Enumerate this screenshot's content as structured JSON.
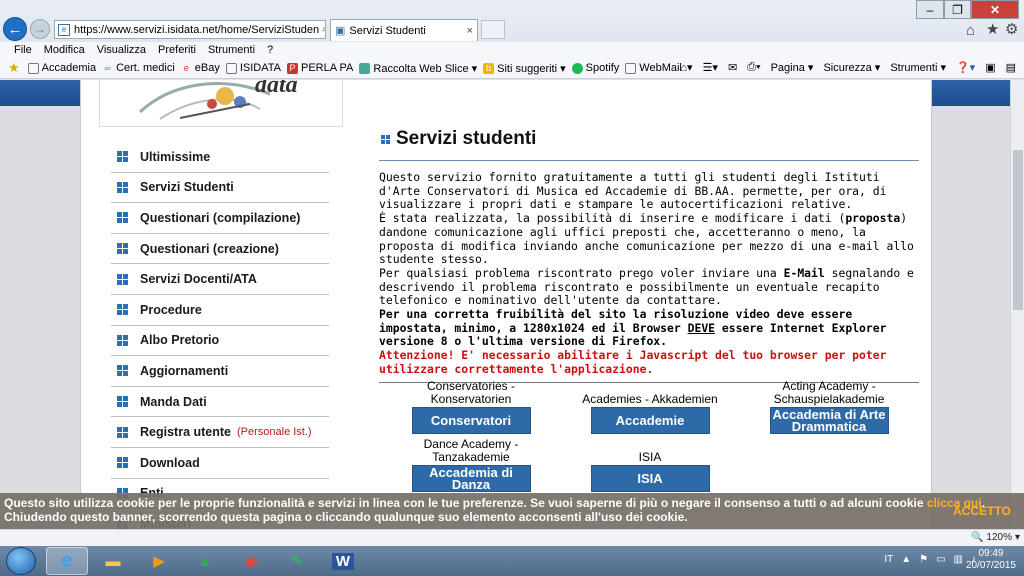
{
  "browser": {
    "url": "https://www.servizi.isidata.net/home/ServiziStuden",
    "tab_title": "Servizi Studenti",
    "tab_close": "×",
    "menu": [
      "File",
      "Modifica",
      "Visualizza",
      "Preferiti",
      "Strumenti",
      "?"
    ],
    "favorites": [
      {
        "label": "Accademia",
        "icon": "page-icon"
      },
      {
        "label": "Cert. medici",
        "icon": "link-icon"
      },
      {
        "label": "eBay",
        "icon": "ebay-icon"
      },
      {
        "label": "ISIDATA",
        "icon": "page-icon"
      },
      {
        "label": "PERLA PA",
        "icon": "perla-icon"
      },
      {
        "label": "Raccolta Web Slice ▾",
        "icon": "slice-icon"
      },
      {
        "label": "Siti suggeriti ▾",
        "icon": "bing-icon"
      },
      {
        "label": "Spotify",
        "icon": "spotify-icon"
      },
      {
        "label": "WebMail",
        "icon": "page-icon"
      }
    ],
    "command_bar": [
      "Pagina ▾",
      "Sicurezza ▾",
      "Strumenti ▾"
    ],
    "zoom": "120%"
  },
  "page": {
    "logo_text": "data",
    "sidebar": [
      {
        "label": "Ultimissime"
      },
      {
        "label": "Servizi Studenti"
      },
      {
        "label": "Questionari (compilazione)"
      },
      {
        "label": "Questionari (creazione)"
      },
      {
        "label": "Servizi Docenti/ATA"
      },
      {
        "label": "Procedure"
      },
      {
        "label": "Albo Pretorio"
      },
      {
        "label": "Aggiornamenti"
      },
      {
        "label": "Manda Dati"
      },
      {
        "label": "Registra utente",
        "sub": "(Personale Ist.)"
      },
      {
        "label": "Download"
      },
      {
        "label": "Enti"
      },
      {
        "label": "Ministeri"
      }
    ],
    "title": "Servizi studenti",
    "intro": {
      "p1": "Questo servizio fornito gratuitamente a tutti gli studenti degli Istituti d'Arte Conservatori di Musica ed Accademie di BB.AA. permette, per ora, di visualizzare i propri dati e stampare le autocertificazioni relative.",
      "p2a": "È stata realizzata, la possibilità di inserire e modificare i dati (",
      "p2b": "proposta",
      "p2c": ") dandone comunicazione agli uffici preposti che, accetteranno o meno, la proposta di modifica inviando anche comunicazione per mezzo di una e-mail allo studente stesso.",
      "p3a": "Per qualsiasi problema riscontrato prego voler inviare una ",
      "p3b": "E-Mail",
      "p3c": " segnalando e descrivendo il problema riscontrato e possibilmente un eventuale recapito telefonico e nominativo dell'utente da contattare.",
      "p4a": "Per una corretta fruibilità del sito la risoluzione video deve essere impostata, minimo, a 1280x1024 ed il Browser ",
      "p4b": "DEVE",
      "p4c": " essere Internet Explorer versione 8 o l'ultima versione di Firefox.",
      "p5": "Attenzione! E' necessario abilitare i Javascript del tuo browser per poter utilizzare correttamente l'applicazione."
    },
    "tiles": [
      {
        "label": "Conservatories - Konservatorien",
        "button": "Conservatori"
      },
      {
        "label": "Academies - Akkademien",
        "button": "Accademie"
      },
      {
        "label": "Acting Academy - Schauspielakademie",
        "button": "Accademia di Arte Drammatica"
      },
      {
        "label": "Dance Academy - Tanzakademie",
        "button": "Accademia di Danza"
      },
      {
        "label": "ISIA",
        "button": "ISIA"
      }
    ]
  },
  "cookie_banner": {
    "text1": "Questo sito utilizza cookie per le proprie funzionalità e servizi in linea con le tue preferenze. Se vuoi saperne di più o negare il consenso a tutti o ad alcuni cookie ",
    "link": "clicca qui",
    "text2": ". Chiudendo questo banner, scorrendo questa pagina o cliccando qualunque suo elemento acconsenti all'uso dei cookie.",
    "accept": "ACCETTO"
  },
  "taskbar": {
    "language": "IT",
    "time": "09:49",
    "date": "20/07/2015"
  }
}
